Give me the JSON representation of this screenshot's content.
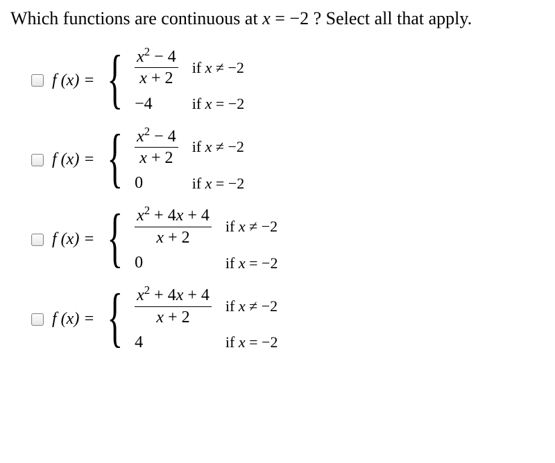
{
  "question": {
    "prefix": "Which functions are continuous at ",
    "var_expr_lhs": "x",
    "var_expr_eq": " = ",
    "var_expr_rhs": "−2",
    "suffix": " ? Select all that apply."
  },
  "options": [
    {
      "fx": "f (x) = ",
      "case1_num_a": "x",
      "case1_num_sup": "2",
      "case1_num_b": " − 4",
      "case1_den_a": "x",
      "case1_den_b": " + 2",
      "cond1_if": "if  ",
      "cond1_var": "x",
      "cond1_rel": " ≠ −2",
      "case2_val": "−4",
      "cond2_if": "if  ",
      "cond2_var": "x",
      "cond2_rel": " = −2"
    },
    {
      "fx": "f (x) = ",
      "case1_num_a": "x",
      "case1_num_sup": "2",
      "case1_num_b": " − 4",
      "case1_den_a": "x",
      "case1_den_b": " + 2",
      "cond1_if": "if  ",
      "cond1_var": "x",
      "cond1_rel": " ≠ −2",
      "case2_val": "0",
      "cond2_if": "if  ",
      "cond2_var": "x",
      "cond2_rel": " = −2"
    },
    {
      "fx": "f (x) = ",
      "case1_num_a": "x",
      "case1_num_sup": "2",
      "case1_num_b": " + 4",
      "case1_num_c": "x",
      "case1_num_d": " + 4",
      "case1_den_a": "x",
      "case1_den_b": " + 2",
      "cond1_if": "if  ",
      "cond1_var": "x",
      "cond1_rel": " ≠ −2",
      "case2_val": "0",
      "cond2_if": "if  ",
      "cond2_var": "x",
      "cond2_rel": " = −2"
    },
    {
      "fx": "f (x) = ",
      "case1_num_a": "x",
      "case1_num_sup": "2",
      "case1_num_b": " + 4",
      "case1_num_c": "x",
      "case1_num_d": " + 4",
      "case1_den_a": "x",
      "case1_den_b": " + 2",
      "cond1_if": "if  ",
      "cond1_var": "x",
      "cond1_rel": " ≠ −2",
      "case2_val": "4",
      "cond2_if": "if  ",
      "cond2_var": "x",
      "cond2_rel": " = −2"
    }
  ]
}
